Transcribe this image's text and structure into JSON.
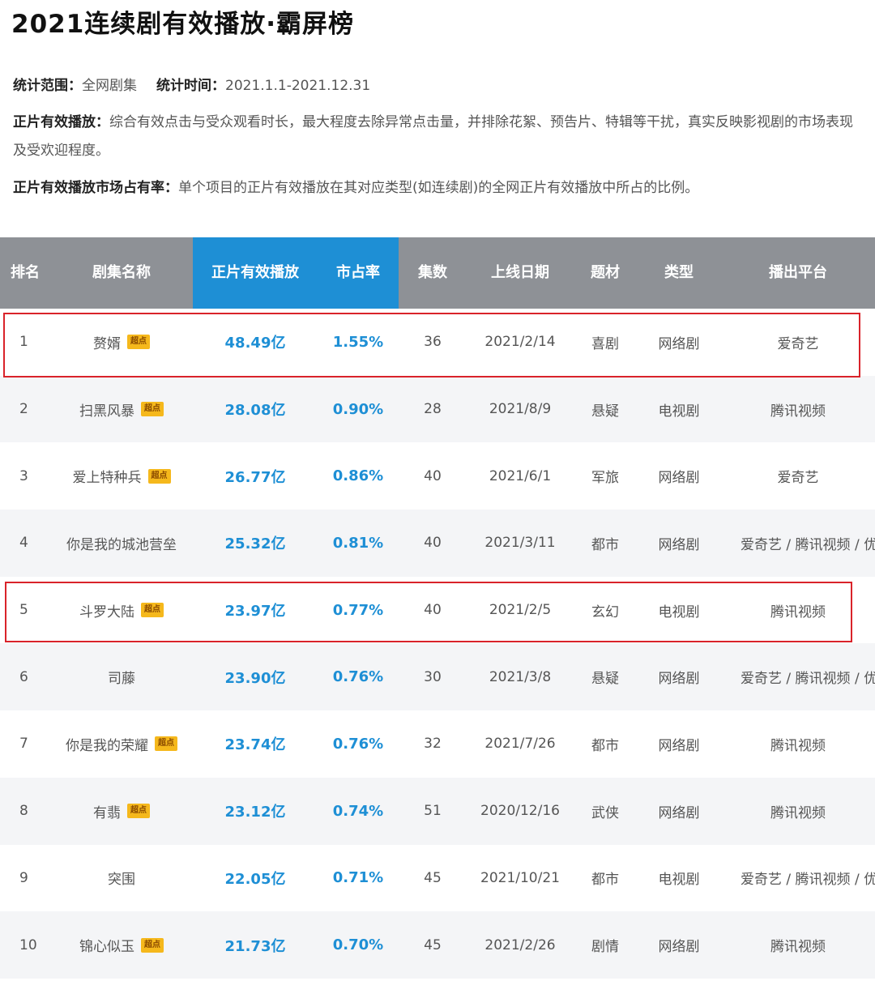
{
  "title": "2021连续剧有效播放·霸屏榜",
  "info": {
    "scope_label": "统计范围：",
    "scope_value": "全网剧集",
    "time_label": "统计时间：",
    "time_value": "2021.1.1-2021.12.31",
    "def1_label": "正片有效播放：",
    "def1_text": "综合有效点击与受众观看时长，最大程度去除异常点击量，并排除花絮、预告片、特辑等干扰，真实反映影视剧的市场表现及受欢迎程度。",
    "def2_label": "正片有效播放市场占有率：",
    "def2_text": "单个项目的正片有效播放在其对应类型(如连续剧)的全网正片有效播放中所占的比例。"
  },
  "table": {
    "headers": [
      "排名",
      "剧集名称",
      "正片有效播放",
      "市占率",
      "集数",
      "上线日期",
      "题材",
      "类型",
      "播出平台"
    ],
    "rows": [
      {
        "rank": "1",
        "name": "赘婿",
        "badge": "超点",
        "play": "48.49亿",
        "share": "1.55%",
        "episodes": "36",
        "date": "2021/2/14",
        "genre": "喜剧",
        "type": "网络剧",
        "platform": "爱奇艺"
      },
      {
        "rank": "2",
        "name": "扫黑风暴",
        "badge": "超点",
        "play": "28.08亿",
        "share": "0.90%",
        "episodes": "28",
        "date": "2021/8/9",
        "genre": "悬疑",
        "type": "电视剧",
        "platform": "腾讯视频"
      },
      {
        "rank": "3",
        "name": "爱上特种兵",
        "badge": "超点",
        "play": "26.77亿",
        "share": "0.86%",
        "episodes": "40",
        "date": "2021/6/1",
        "genre": "军旅",
        "type": "网络剧",
        "platform": "爱奇艺"
      },
      {
        "rank": "4",
        "name": "你是我的城池营垒",
        "badge": "",
        "play": "25.32亿",
        "share": "0.81%",
        "episodes": "40",
        "date": "2021/3/11",
        "genre": "都市",
        "type": "网络剧",
        "platform": "爱奇艺 / 腾讯视频 / 优酷"
      },
      {
        "rank": "5",
        "name": "斗罗大陆",
        "badge": "超点",
        "play": "23.97亿",
        "share": "0.77%",
        "episodes": "40",
        "date": "2021/2/5",
        "genre": "玄幻",
        "type": "电视剧",
        "platform": "腾讯视频"
      },
      {
        "rank": "6",
        "name": "司藤",
        "badge": "",
        "play": "23.90亿",
        "share": "0.76%",
        "episodes": "30",
        "date": "2021/3/8",
        "genre": "悬疑",
        "type": "网络剧",
        "platform": "爱奇艺 / 腾讯视频 / 优酷"
      },
      {
        "rank": "7",
        "name": "你是我的荣耀",
        "badge": "超点",
        "play": "23.74亿",
        "share": "0.76%",
        "episodes": "32",
        "date": "2021/7/26",
        "genre": "都市",
        "type": "网络剧",
        "platform": "腾讯视频"
      },
      {
        "rank": "8",
        "name": "有翡",
        "badge": "超点",
        "play": "23.12亿",
        "share": "0.74%",
        "episodes": "51",
        "date": "2020/12/16",
        "genre": "武侠",
        "type": "网络剧",
        "platform": "腾讯视频"
      },
      {
        "rank": "9",
        "name": "突围",
        "badge": "",
        "play": "22.05亿",
        "share": "0.71%",
        "episodes": "45",
        "date": "2021/10/21",
        "genre": "都市",
        "type": "电视剧",
        "platform": "爱奇艺 / 腾讯视频 / 优酷"
      },
      {
        "rank": "10",
        "name": "锦心似玉",
        "badge": "超点",
        "play": "21.73亿",
        "share": "0.70%",
        "episodes": "45",
        "date": "2021/2/26",
        "genre": "剧情",
        "type": "网络剧",
        "platform": "腾讯视频"
      }
    ]
  },
  "highlights": [
    "1",
    "5"
  ],
  "colors": {
    "header_bg": "#8e9196",
    "accent": "#1e8fd5",
    "badge": "#f5b81c",
    "highlight_border": "#d9232a"
  }
}
